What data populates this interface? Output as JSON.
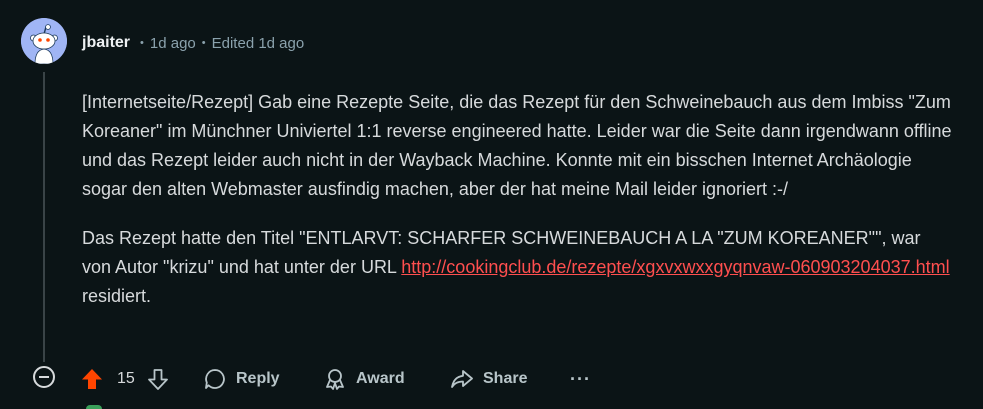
{
  "comment": {
    "username": "jbaiter",
    "posted": "1d ago",
    "edited": "Edited 1d ago",
    "separator": "•",
    "paragraphs": [
      "[Internetseite/Rezept] Gab eine Rezepte Seite, die das Rezept für den Schweinebauch aus dem Imbiss \"Zum Koreaner\" im Münchner Univiertel 1:1 reverse engineered hatte. Leider war die Seite dann irgendwann offline und das Rezept leider auch nicht in der Wayback Machine. Konnte mit ein bisschen Internet Archäologie sogar den alten Webmaster ausfindig machen, aber der hat meine Mail leider ignoriert :-/",
      "Das Rezept hatte den Titel \"ENTLARVT: SCHARFER SCHWEINEBAUCH A LA \"ZUM KOREANER\"\", war von Autor \"krizu\" und hat unter der URL "
    ],
    "link_text": "http://cookingclub.de/rezepte/xgxvxwxxgyqnvaw-060903204037.html",
    "after_link": " residiert.",
    "score": "15"
  },
  "actions": {
    "reply": "Reply",
    "award": "Award",
    "share": "Share",
    "more": "···"
  },
  "colors": {
    "background": "#0b1416",
    "upvote": "#ff4500",
    "link": "#ff4f4f",
    "avatar": "#a0b5f5"
  },
  "icons": [
    "snoo-avatar-icon",
    "collapse-icon",
    "upvote-icon",
    "downvote-icon",
    "comment-icon",
    "award-icon",
    "share-icon",
    "more-icon"
  ]
}
